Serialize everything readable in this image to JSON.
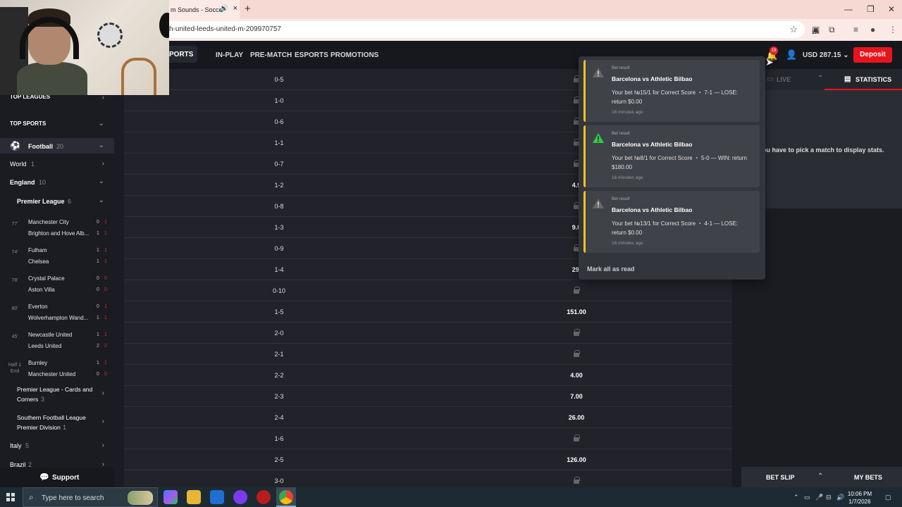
{
  "browser": {
    "tab_title": "m Sounds - Socce",
    "address": "h-united-leeds-united-m-209970757",
    "extension_badge": "394"
  },
  "header": {
    "sports_label": "PORTS",
    "nav": [
      "IN-PLAY",
      "PRE-MATCH",
      "ESPORTS",
      "PROMOTIONS"
    ],
    "notification_count": "19",
    "balance": "USD 287.15",
    "deposit_label": "Deposit"
  },
  "sidebar": {
    "top_leagues": "TOP LEAGUES",
    "top_sports": "TOP SPORTS",
    "football": {
      "label": "Football",
      "count": "20"
    },
    "world": {
      "label": "World",
      "count": "1"
    },
    "england": {
      "label": "England",
      "count": "10"
    },
    "premier_league": {
      "label": "Premier League",
      "count": "6"
    },
    "matches": [
      {
        "time": "77'",
        "team1": "Manchester City",
        "team2": "Brighton and Hove Alb...",
        "s1": "0",
        "s2": "1",
        "r1": "1",
        "r2": "1"
      },
      {
        "time": "74'",
        "team1": "Fulham",
        "team2": "Chelsea",
        "s1": "1",
        "s2": "1",
        "r1": "1",
        "r2": "1"
      },
      {
        "time": "78'",
        "team1": "Crystal Palace",
        "team2": "Aston Villa",
        "s1": "0",
        "s2": "0",
        "r1": "0",
        "r2": "0"
      },
      {
        "time": "80'",
        "team1": "Everton",
        "team2": "Wolverhampton Wand...",
        "s1": "0",
        "s2": "1",
        "r1": "1",
        "r2": "1"
      },
      {
        "time": "45'",
        "team1": "Newcastle United",
        "team2": "Leeds United",
        "s1": "1",
        "s2": "2",
        "r1": "1",
        "r2": "2"
      },
      {
        "time": "Half 1 End",
        "team1": "Burnley",
        "team2": "Manchester United",
        "s1": "1",
        "s2": "0",
        "r1": "1",
        "r2": "0"
      }
    ],
    "pl_cards": {
      "label1": "Premier League - Cards and",
      "label2": "Corners",
      "count": "3"
    },
    "southern": {
      "label1": "Southern Football League",
      "label2": "Premier Division",
      "count": "1"
    },
    "italy": {
      "label": "Italy",
      "count": "5"
    },
    "brazil": {
      "label": "Brazil",
      "count": "2"
    },
    "support_label": "Support"
  },
  "market": {
    "rows": [
      {
        "score": "0-5",
        "odds": "",
        "locked": true
      },
      {
        "score": "1-0",
        "odds": "",
        "locked": true
      },
      {
        "score": "0-6",
        "odds": "",
        "locked": true
      },
      {
        "score": "1-1",
        "odds": "",
        "locked": true
      },
      {
        "score": "0-7",
        "odds": "",
        "locked": true
      },
      {
        "score": "1-2",
        "odds": "4.9",
        "locked": false
      },
      {
        "score": "0-8",
        "odds": "",
        "locked": true
      },
      {
        "score": "1-3",
        "odds": "9.0",
        "locked": false
      },
      {
        "score": "0-9",
        "odds": "",
        "locked": true
      },
      {
        "score": "1-4",
        "odds": "29.",
        "locked": false
      },
      {
        "score": "0-10",
        "odds": "",
        "locked": true
      },
      {
        "score": "1-5",
        "odds": "151.00",
        "locked": false
      },
      {
        "score": "2-0",
        "odds": "",
        "locked": true
      },
      {
        "score": "2-1",
        "odds": "",
        "locked": true
      },
      {
        "score": "2-2",
        "odds": "4.00",
        "locked": false
      },
      {
        "score": "2-3",
        "odds": "7.00",
        "locked": false
      },
      {
        "score": "2-4",
        "odds": "26.00",
        "locked": false
      },
      {
        "score": "1-6",
        "odds": "",
        "locked": true
      },
      {
        "score": "2-5",
        "odds": "126.00",
        "locked": false
      },
      {
        "score": "3-0",
        "odds": "",
        "locked": true
      }
    ]
  },
  "notifications": {
    "items": [
      {
        "type": "Bet result",
        "match": "Barcelona vs Athletic Bilbao",
        "body": "Your bet №15/1 for Correct Score ・ 7-1 — LOSE: return $0.00",
        "time": "16 minutes ago",
        "icon": "warning-grey"
      },
      {
        "type": "Bet result",
        "match": "Barcelona vs Athletic Bilbao",
        "body": "Your bet №8/1 for Correct Score ・ 5-0 — WIN: return $180.00",
        "time": "16 minutes ago",
        "icon": "warning-green"
      },
      {
        "type": "Bet result",
        "match": "Barcelona vs Athletic Bilbao",
        "body": "Your bet №13/1 for Correct Score ・ 4-1 — LOSE: return $0.00",
        "time": "16 minutes ago",
        "icon": "warning-grey"
      }
    ],
    "mark_all": "Mark all as read"
  },
  "right_panel": {
    "live_label": "LIVE",
    "stats_label": "STATISTICS",
    "message": "ou have to pick a match to display stats.",
    "betslip_label": "BET SLIP",
    "mybets_label": "MY BETS"
  },
  "taskbar": {
    "search_placeholder": "Type here to search",
    "time": "10:06 PM",
    "date": "1/7/2026"
  },
  "colors": {
    "accent": "#e8141c",
    "warning_border": "#f0c419",
    "win_icon": "#2ecc40"
  }
}
